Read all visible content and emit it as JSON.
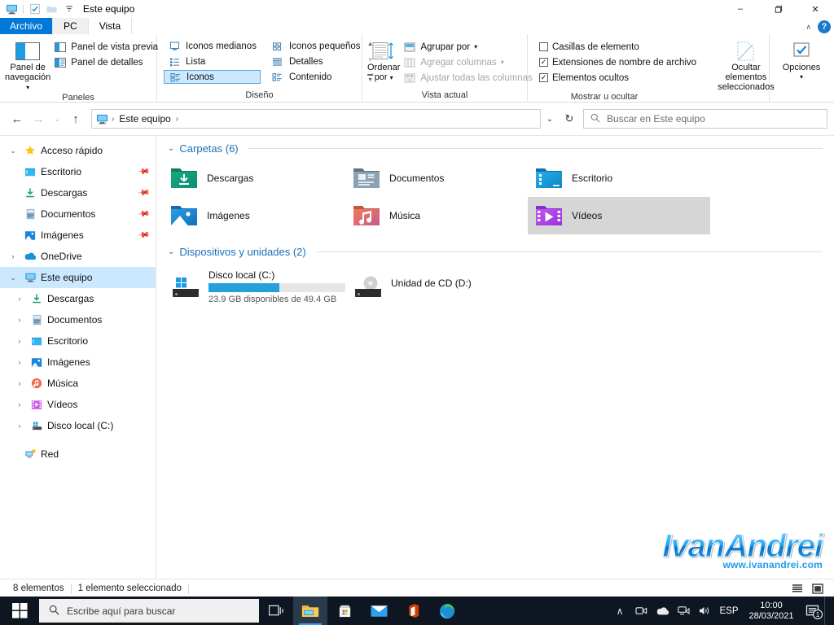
{
  "window": {
    "title": "Este equipo",
    "quick_access_icons": [
      "this-pc-icon",
      "properties-icon",
      "new-folder-icon",
      "customize-qat-icon"
    ],
    "minimize": "–",
    "maximize": "❐",
    "close": "✕",
    "ribbon_collapse": "∧",
    "help": "?"
  },
  "tabs": [
    {
      "label": "Archivo",
      "kind": "file"
    },
    {
      "label": "PC",
      "kind": "normal"
    },
    {
      "label": "Vista",
      "kind": "active"
    }
  ],
  "ribbon": {
    "groups": [
      {
        "label": "Paneles",
        "big_button": {
          "label_line1": "Panel de",
          "label_line2": "navegación",
          "icon": "navigation-pane-icon",
          "has_dropdown": true
        },
        "items": [
          {
            "label": "Panel de vista previa",
            "icon": "preview-pane-icon",
            "disabled": false
          },
          {
            "label": "Panel de detalles",
            "icon": "details-pane-icon",
            "disabled": false
          }
        ]
      },
      {
        "label": "Diseño",
        "columns": [
          [
            {
              "label": "Iconos medianos",
              "icon": "medium-icons-icon",
              "selected": false
            },
            {
              "label": "Lista",
              "icon": "list-view-icon",
              "selected": false
            },
            {
              "label": "Iconos",
              "icon": "tiles-view-icon",
              "selected": true
            }
          ],
          [
            {
              "label": "Iconos pequeños",
              "icon": "small-icons-icon",
              "selected": false
            },
            {
              "label": "Detalles",
              "icon": "details-view-icon",
              "selected": false
            },
            {
              "label": "Contenido",
              "icon": "content-view-icon",
              "selected": false
            }
          ]
        ],
        "scroll": {
          "up": "▲",
          "down": "▼",
          "more": "☰"
        }
      },
      {
        "label": "Vista actual",
        "big_button": {
          "label_line1": "Ordenar",
          "label_line2": "por",
          "icon": "sort-by-icon",
          "has_dropdown": true
        },
        "items": [
          {
            "label": "Agrupar por",
            "icon": "group-by-icon",
            "disabled": false,
            "has_dropdown": true
          },
          {
            "label": "Agregar columnas",
            "icon": "add-columns-icon",
            "disabled": true,
            "has_dropdown": true
          },
          {
            "label": "Ajustar todas las columnas",
            "icon": "fit-columns-icon",
            "disabled": true
          }
        ]
      },
      {
        "label": "Mostrar u ocultar",
        "checkboxes": [
          {
            "label": "Casillas de elemento",
            "checked": false
          },
          {
            "label": "Extensiones de nombre de archivo",
            "checked": true
          },
          {
            "label": "Elementos ocultos",
            "checked": true
          }
        ],
        "hide_selected": {
          "label_line1": "Ocultar elementos",
          "label_line2": "seleccionados",
          "icon": "hide-items-icon"
        }
      },
      {
        "label": "",
        "options_button": {
          "label": "Opciones",
          "icon": "options-icon",
          "has_dropdown": true
        }
      }
    ]
  },
  "navbar": {
    "back": "←",
    "forward": "→",
    "recent": "⌄",
    "up": "↑",
    "breadcrumb": {
      "root_icon": "this-pc-icon",
      "items": [
        "Este equipo"
      ],
      "separator": "›"
    },
    "address_dropdown": "⌄",
    "refresh": "↻",
    "search_placeholder": "Buscar en Este equipo",
    "search_value": "",
    "search_icon": "search-icon"
  },
  "sidebar": {
    "items": [
      {
        "label": "Acceso rápido",
        "icon": "star-icon",
        "indent": 0,
        "expander": "open",
        "pinned": false,
        "selected": false
      },
      {
        "label": "Escritorio",
        "icon": "desktop-folder-icon",
        "indent": 1,
        "expander": "none",
        "pinned": true,
        "selected": false
      },
      {
        "label": "Descargas",
        "icon": "downloads-icon",
        "indent": 1,
        "expander": "none",
        "pinned": true,
        "selected": false
      },
      {
        "label": "Documentos",
        "icon": "documents-icon",
        "indent": 1,
        "expander": "none",
        "pinned": true,
        "selected": false
      },
      {
        "label": "Imágenes",
        "icon": "pictures-icon",
        "indent": 1,
        "expander": "none",
        "pinned": true,
        "selected": false
      },
      {
        "label": "OneDrive",
        "icon": "onedrive-icon",
        "indent": 0,
        "expander": "closed",
        "pinned": false,
        "selected": false
      },
      {
        "label": "Este equipo",
        "icon": "this-pc-icon",
        "indent": 0,
        "expander": "open",
        "pinned": false,
        "selected": true
      },
      {
        "label": "Descargas",
        "icon": "downloads-icon",
        "indent": 1,
        "expander": "closed",
        "pinned": false,
        "selected": false
      },
      {
        "label": "Documentos",
        "icon": "documents-icon",
        "indent": 1,
        "expander": "closed",
        "pinned": false,
        "selected": false
      },
      {
        "label": "Escritorio",
        "icon": "desktop-folder-icon",
        "indent": 1,
        "expander": "closed",
        "pinned": false,
        "selected": false
      },
      {
        "label": "Imágenes",
        "icon": "pictures-icon",
        "indent": 1,
        "expander": "closed",
        "pinned": false,
        "selected": false
      },
      {
        "label": "Música",
        "icon": "music-icon",
        "indent": 1,
        "expander": "closed",
        "pinned": false,
        "selected": false
      },
      {
        "label": "Vídeos",
        "icon": "videos-icon",
        "indent": 1,
        "expander": "closed",
        "pinned": false,
        "selected": false
      },
      {
        "label": "Disco local (C:)",
        "icon": "harddrive-icon",
        "indent": 1,
        "expander": "closed",
        "pinned": false,
        "selected": false
      },
      {
        "label": "Red",
        "icon": "network-icon",
        "indent": 0,
        "expander": "none",
        "pinned": false,
        "selected": false
      }
    ]
  },
  "content": {
    "folders_group": {
      "title": "Carpetas (6)",
      "chevron": "⌄",
      "items": [
        {
          "label": "Descargas",
          "icon": "downloads-folder-icon",
          "selected": false
        },
        {
          "label": "Documentos",
          "icon": "documents-folder-icon",
          "selected": false
        },
        {
          "label": "Escritorio",
          "icon": "desktop-folder-icon",
          "selected": false
        },
        {
          "label": "Imágenes",
          "icon": "pictures-folder-icon",
          "selected": false
        },
        {
          "label": "Música",
          "icon": "music-folder-icon",
          "selected": false
        },
        {
          "label": "Vídeos",
          "icon": "videos-folder-icon",
          "selected": true
        }
      ]
    },
    "devices_group": {
      "title": "Dispositivos y unidades (2)",
      "chevron": "⌄",
      "items": [
        {
          "label": "Disco local (C:)",
          "icon": "local-disk-icon",
          "has_bar": true,
          "used_percent": 52,
          "free_text": "23.9 GB disponibles de 49.4 GB",
          "bar_color": "#26a0da"
        },
        {
          "label": "Unidad de CD (D:)",
          "icon": "cd-drive-icon",
          "has_bar": false,
          "used_percent": 0,
          "free_text": "",
          "bar_color": "#26a0da"
        }
      ]
    },
    "watermark": {
      "main": "IvanAndrei",
      "sub": "www.ivanandrei.com"
    }
  },
  "statusbar": {
    "item_count": "8 elementos",
    "selection": "1 elemento seleccionado",
    "details_view_icon": "details-view-icon",
    "large_icons_view_icon": "large-icons-view-icon"
  },
  "taskbar": {
    "start_icon": "windows-start-icon",
    "search_placeholder": "Escribe aquí para buscar",
    "search_icon": "search-icon",
    "buttons": [
      {
        "name": "task-view-icon",
        "active": false
      },
      {
        "name": "file-explorer-icon",
        "active": true
      },
      {
        "name": "microsoft-store-icon",
        "active": false
      },
      {
        "name": "mail-icon",
        "active": false
      },
      {
        "name": "office-icon",
        "active": false
      },
      {
        "name": "edge-icon",
        "active": false
      }
    ],
    "tray": {
      "show_hidden": "∧",
      "icons": [
        "webcam-icon",
        "onedrive-icon",
        "network-icon",
        "volume-icon"
      ],
      "language": "ESP",
      "time": "10:00",
      "date": "28/03/2021",
      "notifications_icon": "notifications-icon",
      "notifications_count": "1"
    }
  },
  "colors": {
    "accent": "#0078d7",
    "ribbon_selected": "#cce8ff",
    "tile_selected": "#d6d6d6",
    "link_blue": "#1a6fb5",
    "taskbar_bg": "#0e1621"
  }
}
